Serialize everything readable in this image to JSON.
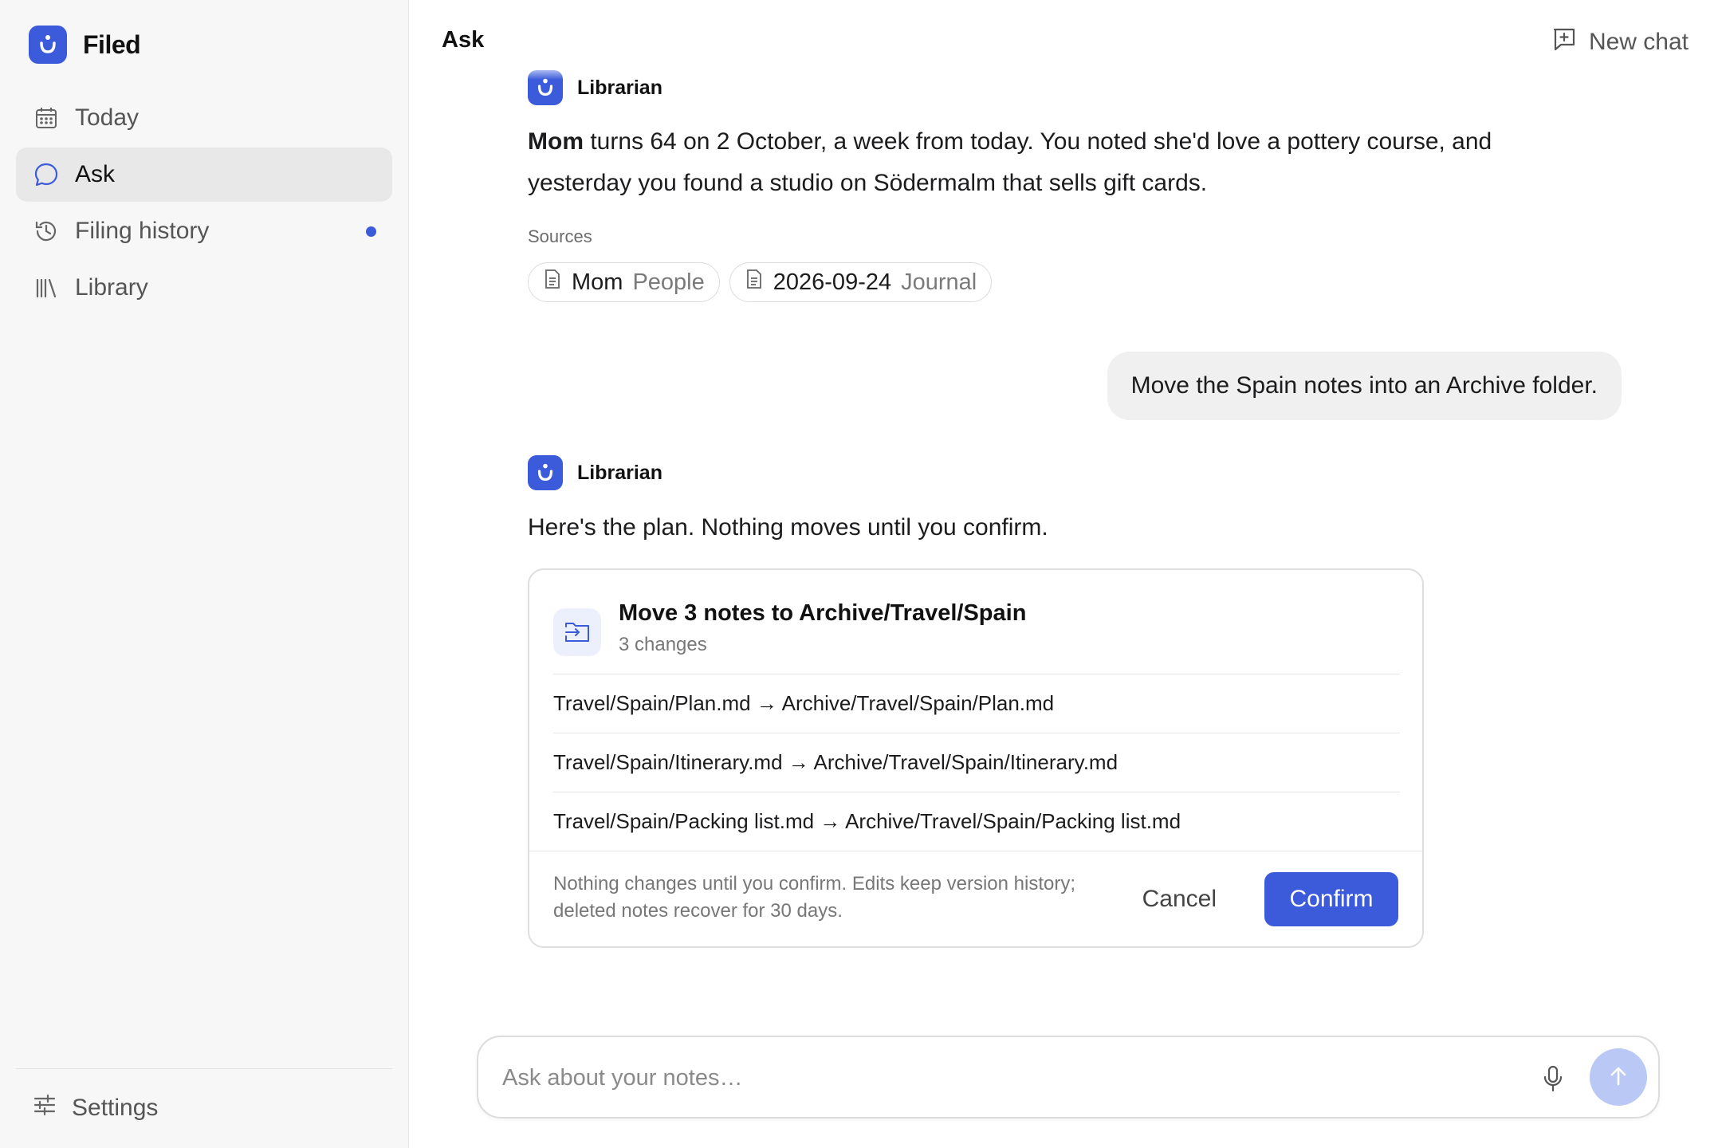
{
  "app": {
    "name": "Filed"
  },
  "sidebar": {
    "items": [
      {
        "label": "Today",
        "icon": "calendar-icon",
        "active": false
      },
      {
        "label": "Ask",
        "icon": "chat-bubble-icon",
        "active": true
      },
      {
        "label": "Filing history",
        "icon": "history-icon",
        "active": false,
        "badge_dot": true
      },
      {
        "label": "Library",
        "icon": "library-icon",
        "active": false
      }
    ],
    "settings_label": "Settings"
  },
  "header": {
    "title": "Ask",
    "new_chat_label": "New chat"
  },
  "conversation": {
    "agent_name": "Librarian",
    "first_reply": {
      "bold": "Mom",
      "text": " turns 64 on 2 October, a week from today. You noted she'd love a pottery course, and yesterday you found a studio on Södermalm that sells gift cards."
    },
    "sources_label": "Sources",
    "sources": [
      {
        "title": "Mom",
        "type": "People"
      },
      {
        "title": "2026-09-24",
        "type": "Journal"
      }
    ],
    "user_message": "Move the Spain notes into an Archive folder.",
    "second_reply": "Here's the plan. Nothing moves until you confirm.",
    "plan": {
      "title": "Move 3 notes to Archive/Travel/Spain",
      "subtitle": "3 changes",
      "rows": [
        "Travel/Spain/Plan.md → Archive/Travel/Spain/Plan.md",
        "Travel/Spain/Itinerary.md → Archive/Travel/Spain/Itinerary.md",
        "Travel/Spain/Packing list.md → Archive/Travel/Spain/Packing list.md"
      ],
      "note": "Nothing changes until you confirm. Edits keep version history; deleted notes recover for 30 days.",
      "cancel_label": "Cancel",
      "confirm_label": "Confirm"
    }
  },
  "composer": {
    "placeholder": "Ask about your notes…",
    "value": ""
  },
  "colors": {
    "accent": "#3b5bdb",
    "send_disabled": "#b9c8f5",
    "sidebar_bg": "#f7f7f7"
  }
}
